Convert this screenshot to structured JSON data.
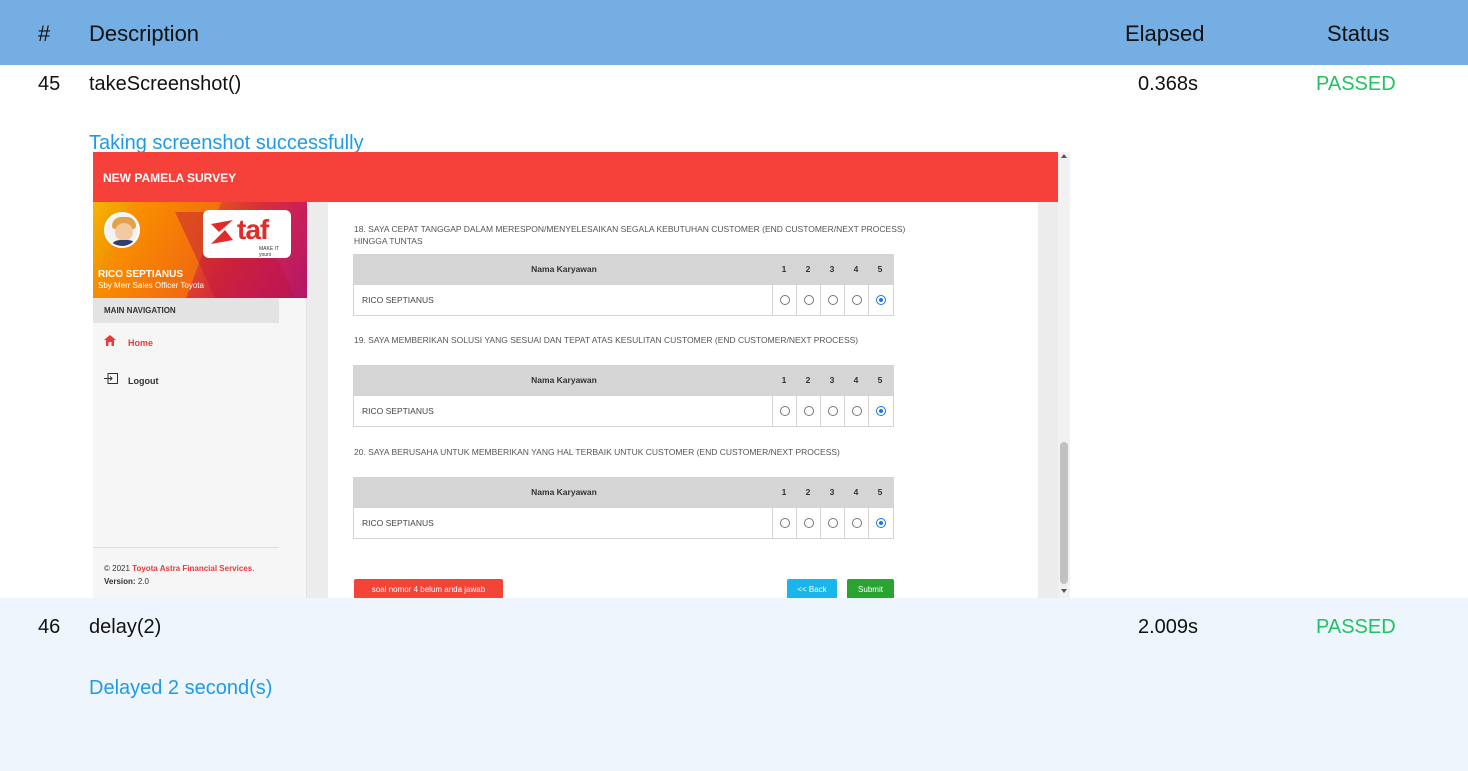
{
  "report": {
    "headers": {
      "num": "#",
      "description": "Description",
      "elapsed": "Elapsed",
      "status": "Status"
    },
    "rows": [
      {
        "num": "45",
        "description": "takeScreenshot()",
        "elapsed": "0.368s",
        "status": "PASSED",
        "message": "Taking screenshot successfully"
      },
      {
        "num": "46",
        "description": "delay(2)",
        "elapsed": "2.009s",
        "status": "PASSED",
        "message": "Delayed 2 second(s)"
      }
    ]
  },
  "screenshot": {
    "app_title": "NEW PAMELA SURVEY",
    "profile": {
      "name": "RICO SEPTIANUS",
      "role": "Sby Merr Sales Officer Toyota",
      "logo_text": "taf",
      "logo_tagline": "MAKE IT yours"
    },
    "nav": {
      "title": "MAIN NAVIGATION",
      "home": "Home",
      "logout": "Logout"
    },
    "footer": {
      "copyright": "© 2021",
      "company": "Toyota Astra Financial Services",
      "dot": ".",
      "version_label": "Version:",
      "version_value": "2.0"
    },
    "table_header": "Nama Karyawan",
    "scale": [
      "1",
      "2",
      "3",
      "4",
      "5"
    ],
    "questions": [
      {
        "text": "18. SAYA CEPAT TANGGAP DALAM MERESPON/MENYELESAIKAN SEGALA KEBUTUHAN CUSTOMER (END CUSTOMER/NEXT PROCESS) HINGGA TUNTAS",
        "employee": "RICO SEPTIANUS",
        "selected": 5
      },
      {
        "text": "19. SAYA MEMBERIKAN SOLUSI YANG SESUAI DAN TEPAT ATAS KESULITAN CUSTOMER (END CUSTOMER/NEXT PROCESS)",
        "employee": "RICO SEPTIANUS",
        "selected": 5
      },
      {
        "text": "20. SAYA BERUSAHA UNTUK MEMBERIKAN YANG HAL TERBAIK UNTUK CUSTOMER (END CUSTOMER/NEXT PROCESS)",
        "employee": "RICO SEPTIANUS",
        "selected": 5
      }
    ],
    "buttons": {
      "warning": "soal nomor 4 belum anda jawab",
      "back": "<< Back",
      "submit": "Submit"
    },
    "colors": {
      "header": "#f5413a",
      "accent_red": "#e83a3a",
      "back": "#19b6ec",
      "submit": "#2aa431",
      "radio": "#1a73e8"
    }
  }
}
